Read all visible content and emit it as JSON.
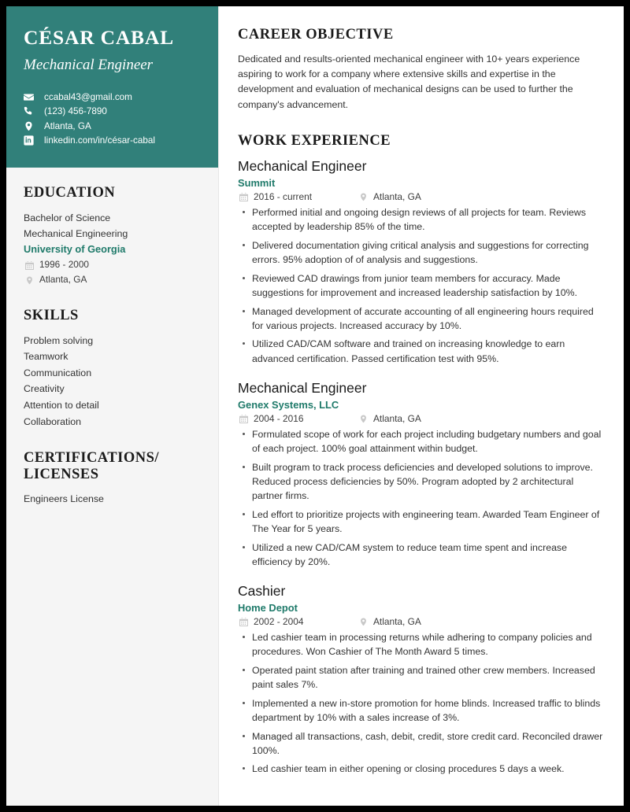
{
  "accent_colors": {
    "header_background": "#31807a",
    "accent_text": "#1f7a6a",
    "sidebar_background": "#f5f5f5",
    "body_text": "#333333",
    "page_border": "#000000"
  },
  "sidebar": {
    "name": "CÉSAR CABAL",
    "role": "Mechanical Engineer",
    "contacts": [
      {
        "icon": "envelope-icon",
        "text": "ccabal43@gmail.com"
      },
      {
        "icon": "phone-icon",
        "text": "(123) 456-7890"
      },
      {
        "icon": "map-pin-icon",
        "text": "Atlanta, GA"
      },
      {
        "icon": "linkedin-icon",
        "text": "linkedin.com/in/césar-cabal"
      }
    ],
    "education": {
      "heading": "EDUCATION",
      "degree": "Bachelor of Science",
      "field": "Mechanical Engineering",
      "school": "University of Georgia",
      "dates": "1996 - 2000",
      "location": "Atlanta, GA"
    },
    "skills": {
      "heading": "SKILLS",
      "items": [
        "Problem solving",
        "Teamwork",
        "Communication",
        "Creativity",
        "Attention to detail",
        "Collaboration"
      ]
    },
    "certifications": {
      "heading": "CERTIFICATIONS/ LICENSES",
      "items": [
        "Engineers License"
      ]
    }
  },
  "main": {
    "objective": {
      "heading": "CAREER OBJECTIVE",
      "text": "Dedicated and results-oriented mechanical engineer with 10+ years experience aspiring to work for a company where extensive skills and expertise in the development and evaluation of mechanical designs can be used to further the company's advancement."
    },
    "work": {
      "heading": "WORK EXPERIENCE",
      "jobs": [
        {
          "title": "Mechanical Engineer",
          "company": "Summit",
          "dates": "2016 - current",
          "location": "Atlanta, GA",
          "bullets": [
            "Performed initial and ongoing design reviews of all projects for team. Reviews accepted by leadership 85% of the time.",
            "Delivered documentation giving critical analysis and suggestions for correcting errors. 95% adoption of of analysis and suggestions.",
            "Reviewed CAD drawings from junior team members for accuracy. Made suggestions for improvement and increased leadership satisfaction by 10%.",
            "Managed development of accurate accounting of all engineering hours required for various projects. Increased accuracy by 10%.",
            "Utilized CAD/CAM software and trained on increasing knowledge to earn advanced certification. Passed certification test with 95%."
          ]
        },
        {
          "title": "Mechanical Engineer",
          "company": "Genex Systems, LLC",
          "dates": "2004 - 2016",
          "location": "Atlanta, GA",
          "bullets": [
            "Formulated scope of work for each project including budgetary numbers and goal of each project. 100% goal attainment within budget.",
            "Built program to track process deficiencies and developed solutions to improve. Reduced process deficiencies by 50%. Program adopted by 2 architectural partner firms.",
            "Led effort to prioritize projects with engineering team. Awarded Team Engineer of The Year for 5 years.",
            "Utilized a new CAD/CAM system to reduce team time spent and increase efficiency by 20%."
          ]
        },
        {
          "title": "Cashier",
          "company": "Home Depot",
          "dates": "2002 - 2004",
          "location": "Atlanta, GA",
          "bullets": [
            "Led cashier team in processing returns while adhering to company policies and procedures. Won Cashier of The Month Award 5 times.",
            "Operated paint station after training and trained other crew members. Increased paint sales 7%.",
            "Implemented a new in-store promotion for home blinds. Increased traffic to blinds department by 10% with a sales increase of 3%.",
            "Managed all transactions, cash, debit, credit, store credit card. Reconciled drawer 100%.",
            "Led cashier team in either opening or closing procedures 5 days a week."
          ]
        }
      ]
    }
  }
}
